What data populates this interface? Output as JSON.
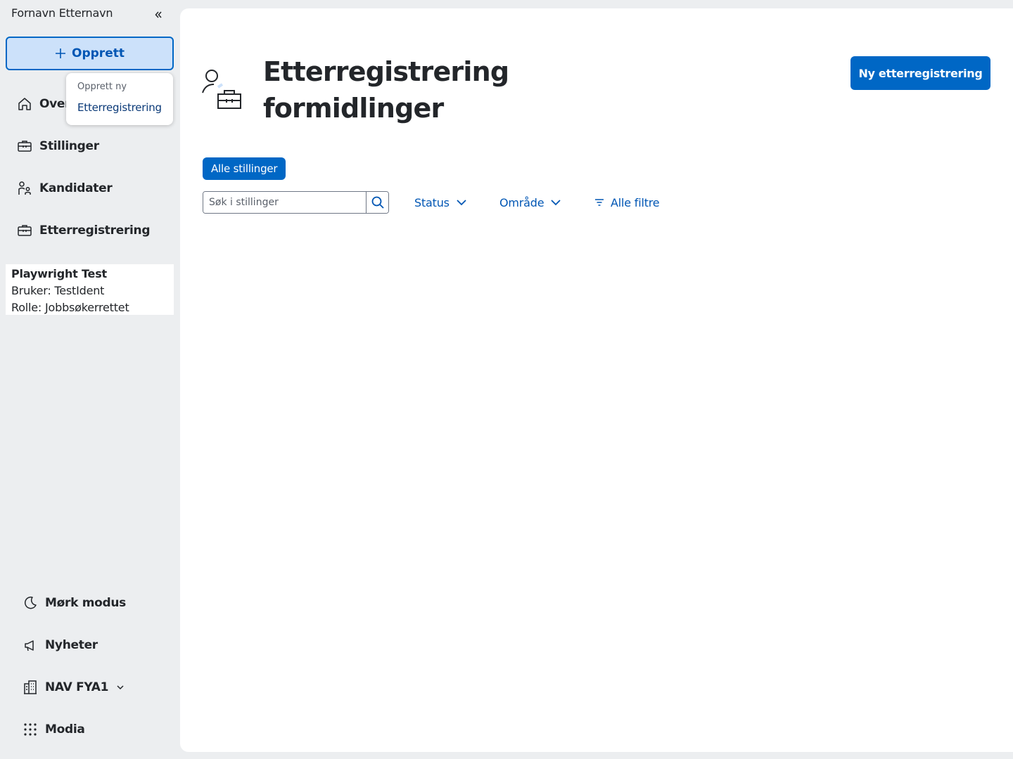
{
  "sidebar": {
    "user_name": "Fornavn Etternavn",
    "create_label": "Opprett",
    "nav": [
      {
        "label": "Oversikt",
        "icon": "house-icon"
      },
      {
        "label": "Stillinger",
        "icon": "briefcase-icon"
      },
      {
        "label": "Kandidater",
        "icon": "person-group-icon"
      },
      {
        "label": "Etterregistrering",
        "icon": "briefcase-icon"
      }
    ],
    "popover": {
      "heading": "Opprett ny",
      "item": "Etterregistrering"
    },
    "user_card": {
      "name": "Playwright Test",
      "user": "Bruker: TestIdent",
      "role": "Rolle: Jobbsøkerrettet"
    },
    "bottom": [
      {
        "label": "Mørk modus",
        "icon": "moon-icon"
      },
      {
        "label": "Nyheter",
        "icon": "megaphone-icon"
      },
      {
        "label": "NAV FYA1",
        "icon": "building-icon"
      },
      {
        "label": "Modia",
        "icon": "grid-icon"
      }
    ]
  },
  "main": {
    "title": "Etterregistrering formidlinger",
    "primary_button": "Ny etterregistrering",
    "chip": "Alle stillinger",
    "search_placeholder": "Søk i stillinger",
    "filters": {
      "status": "Status",
      "area": "Område",
      "all": "Alle filtre"
    }
  },
  "colors": {
    "accent": "#0067c5",
    "link": "#0056b4",
    "sidebar_bg": "#eceef0",
    "create_bg": "#cce1fa"
  }
}
